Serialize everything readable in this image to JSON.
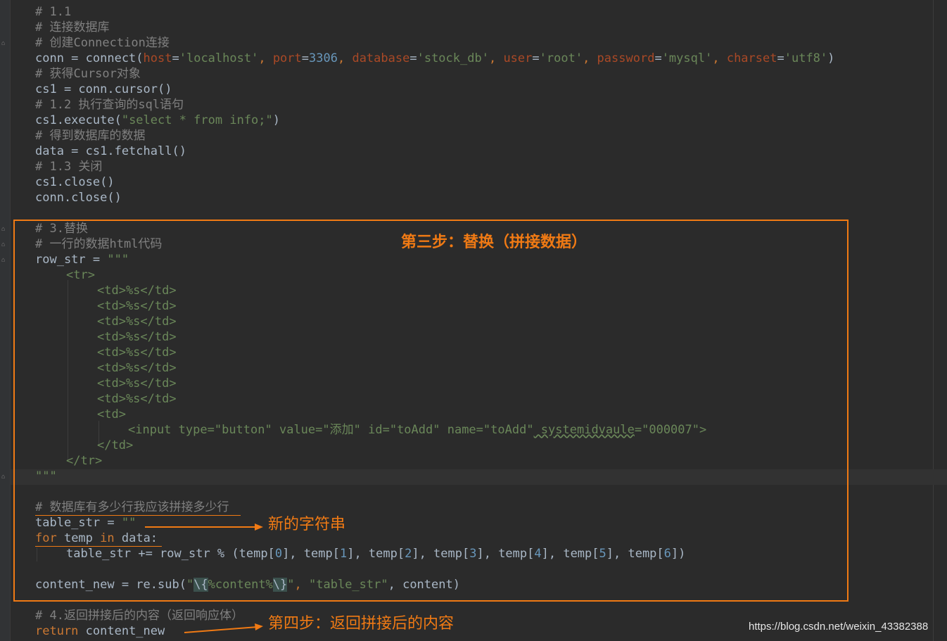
{
  "code": {
    "lines": [
      {
        "text": "# 1.1"
      },
      {
        "text": "# 连接数据库"
      },
      {
        "text": "# 创建Connection连接"
      },
      {
        "prefix": "conn = connect(",
        "p1": "host",
        "eq1": "=",
        "s1": "'localhost'",
        "c1": ", ",
        "p2": "port",
        "eq2": "=",
        "n2": "3306",
        "c2": ", ",
        "p3": "database",
        "eq3": "=",
        "s3": "'stock_db'",
        "c3": ", ",
        "p4": "user",
        "eq4": "=",
        "s4": "'root'",
        "c4": ", ",
        "p5": "password",
        "eq5": "=",
        "s5": "'mysql'",
        "c5": ", ",
        "p6": "charset",
        "eq6": "=",
        "s6": "'utf8'",
        "end": ")"
      },
      {
        "text": "# 获得Cursor对象"
      },
      {
        "text": "cs1 = conn.cursor()"
      },
      {
        "text": "# 1.2 执行查询的sql语句"
      },
      {
        "prefix": "cs1.execute(",
        "str": "\"select * from info;\"",
        "end": ")"
      },
      {
        "text": "# 得到数据库的数据"
      },
      {
        "text": "data = cs1.fetchall()"
      },
      {
        "text": "# 1.3 关闭"
      },
      {
        "text": "cs1.close()"
      },
      {
        "text": "conn.close()"
      },
      {
        "text": "# 3.替换"
      },
      {
        "text": "# 一行的数据html代码"
      },
      {
        "prefix": "row_str = ",
        "str": "\"\"\""
      },
      {
        "text": "<tr>"
      },
      {
        "text": "<td>%s</td>"
      },
      {
        "text": "<td>%s</td>"
      },
      {
        "text": "<td>%s</td>"
      },
      {
        "text": "<td>%s</td>"
      },
      {
        "text": "<td>%s</td>"
      },
      {
        "text": "<td>%s</td>"
      },
      {
        "text": "<td>%s</td>"
      },
      {
        "text": "<td>%s</td>"
      },
      {
        "text": "<td>"
      },
      {
        "tag": "<input ",
        "a1": "type=",
        "v1": "\"button\"",
        "a2": " value=",
        "v2": "\"添加\"",
        "a3": " id=",
        "v3": "\"toAdd\"",
        "a4": " name=",
        "v4": "\"toAdd\"",
        "a5": " systemidvaule",
        "a5eq": "=",
        "v5": "\"000007\"",
        "tagend": ">"
      },
      {
        "text": "</td>"
      },
      {
        "text": "</tr>"
      },
      {
        "text": "\"\"\""
      },
      {
        "text": "# 数据库有多少行我应该拼接多少行"
      },
      {
        "prefix": "table_str = ",
        "str": "\"\""
      },
      {
        "kw1": "for",
        "mid1": " temp ",
        "kw2": "in",
        "mid2": " data:"
      },
      {
        "a": "table_str += row_str % (temp[",
        "i0": "0",
        "b": "], temp[",
        "i1": "1",
        "i2": "2",
        "i3": "3",
        "i4": "4",
        "i5": "5",
        "i6": "6",
        "z": "])"
      },
      {
        "prefix": "content_new = re.sub(",
        "q1": "\"",
        "re1": "\\{",
        "re2": "%content%",
        "re3": "\\}",
        "q2": "\"",
        "mid": ", ",
        "s2": "\"table_str\"",
        "end": ", content)"
      },
      {
        "text": "# 4.返回拼接后的内容（返回响应体）"
      },
      {
        "kw": "return",
        "rest": " content_new"
      }
    ]
  },
  "annotations": {
    "step3": "第三步：替换（拼接数据）",
    "new_string": "新的字符串",
    "step4": "第四步：返回拼接后的内容"
  },
  "watermark": "https://blog.csdn.net/weixin_43382388",
  "colors": {
    "background": "#2b2b2b",
    "comment": "#808080",
    "keyword": "#cc7832",
    "string": "#6a8759",
    "number": "#6897bb",
    "param": "#aa4926",
    "annotation": "#f07a14"
  }
}
